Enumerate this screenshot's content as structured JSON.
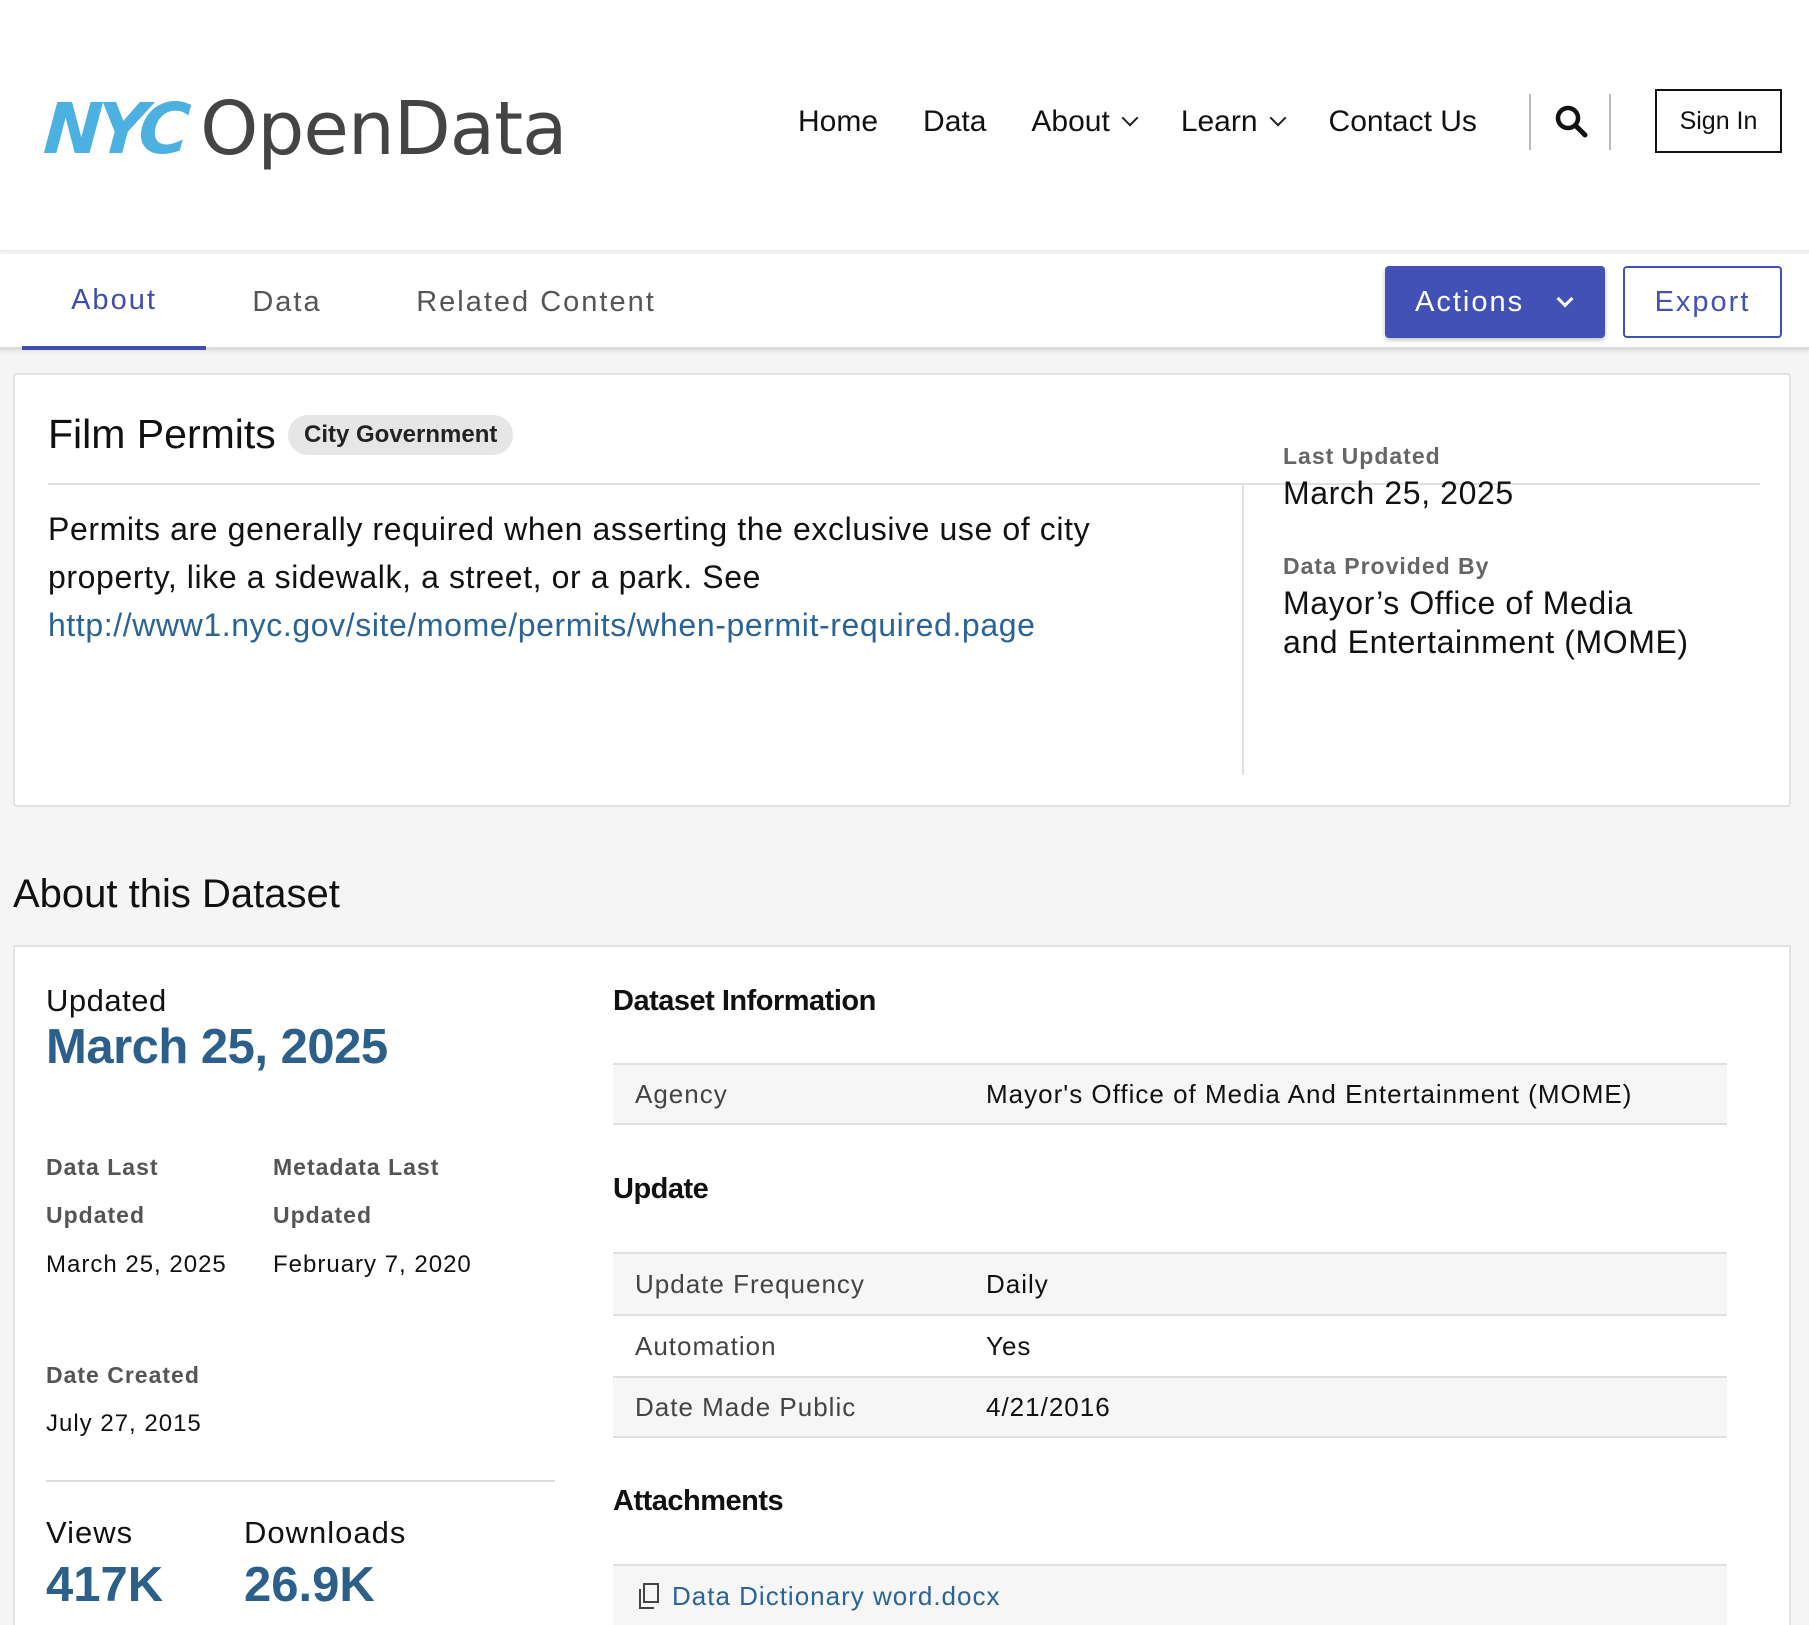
{
  "header": {
    "logo": {
      "mark": "NYC",
      "text": "OpenData"
    },
    "nav": [
      {
        "label": "Home",
        "has_dropdown": false
      },
      {
        "label": "Data",
        "has_dropdown": false
      },
      {
        "label": "About",
        "has_dropdown": true
      },
      {
        "label": "Learn",
        "has_dropdown": true
      },
      {
        "label": "Contact Us",
        "has_dropdown": false
      }
    ],
    "search_icon": "search-icon",
    "sign_in_label": "Sign In"
  },
  "tabs": {
    "items": [
      {
        "label": "About",
        "active": true
      },
      {
        "label": "Data",
        "active": false
      },
      {
        "label": "Related Content",
        "active": false
      }
    ],
    "actions_label": "Actions",
    "export_label": "Export"
  },
  "summary": {
    "title": "Film Permits",
    "category": "City Government",
    "description": "Permits are generally required when asserting the exclusive use of city property, like a sidewalk, a street, or a park. See",
    "link": "http://www1.nyc.gov/site/mome/permits/when-permit-required.page",
    "last_updated_label": "Last Updated",
    "last_updated": "March 25, 2025",
    "provided_by_label": "Data Provided By",
    "provided_by_line1": "Mayor’s Office of Media",
    "provided_by_line2": "and Entertainment (MOME)"
  },
  "about": {
    "heading": "About this Dataset",
    "updated_label": "Updated",
    "updated_value": "March 25, 2025",
    "data_last_updated_label_1": "Data Last",
    "data_last_updated_label_2": "Updated",
    "data_last_updated_value": "March 25, 2025",
    "metadata_last_updated_label_1": "Metadata Last",
    "metadata_last_updated_label_2": "Updated",
    "metadata_last_updated_value": "February 7, 2020",
    "date_created_label": "Date Created",
    "date_created_value": "July 27, 2015",
    "views_label": "Views",
    "views_value": "417K",
    "downloads_label": "Downloads",
    "downloads_value": "26.9K",
    "dataset_info_title": "Dataset Information",
    "dataset_info_rows": [
      {
        "key": "Agency",
        "value": "Mayor's Office of Media And Entertainment (MOME)"
      }
    ],
    "update_title": "Update",
    "update_rows": [
      {
        "key": "Update Frequency",
        "value": "Daily"
      },
      {
        "key": "Automation",
        "value": "Yes"
      },
      {
        "key": "Date Made Public",
        "value": "4/21/2016"
      }
    ],
    "attachments_title": "Attachments",
    "attachments": [
      {
        "icon": "document-icon",
        "name": "Data Dictionary word.docx"
      }
    ]
  },
  "colors": {
    "accent": "#4350b5",
    "link": "#2a6496",
    "stat": "#2c5f8a",
    "logo_blue": "#4cb1e0"
  }
}
